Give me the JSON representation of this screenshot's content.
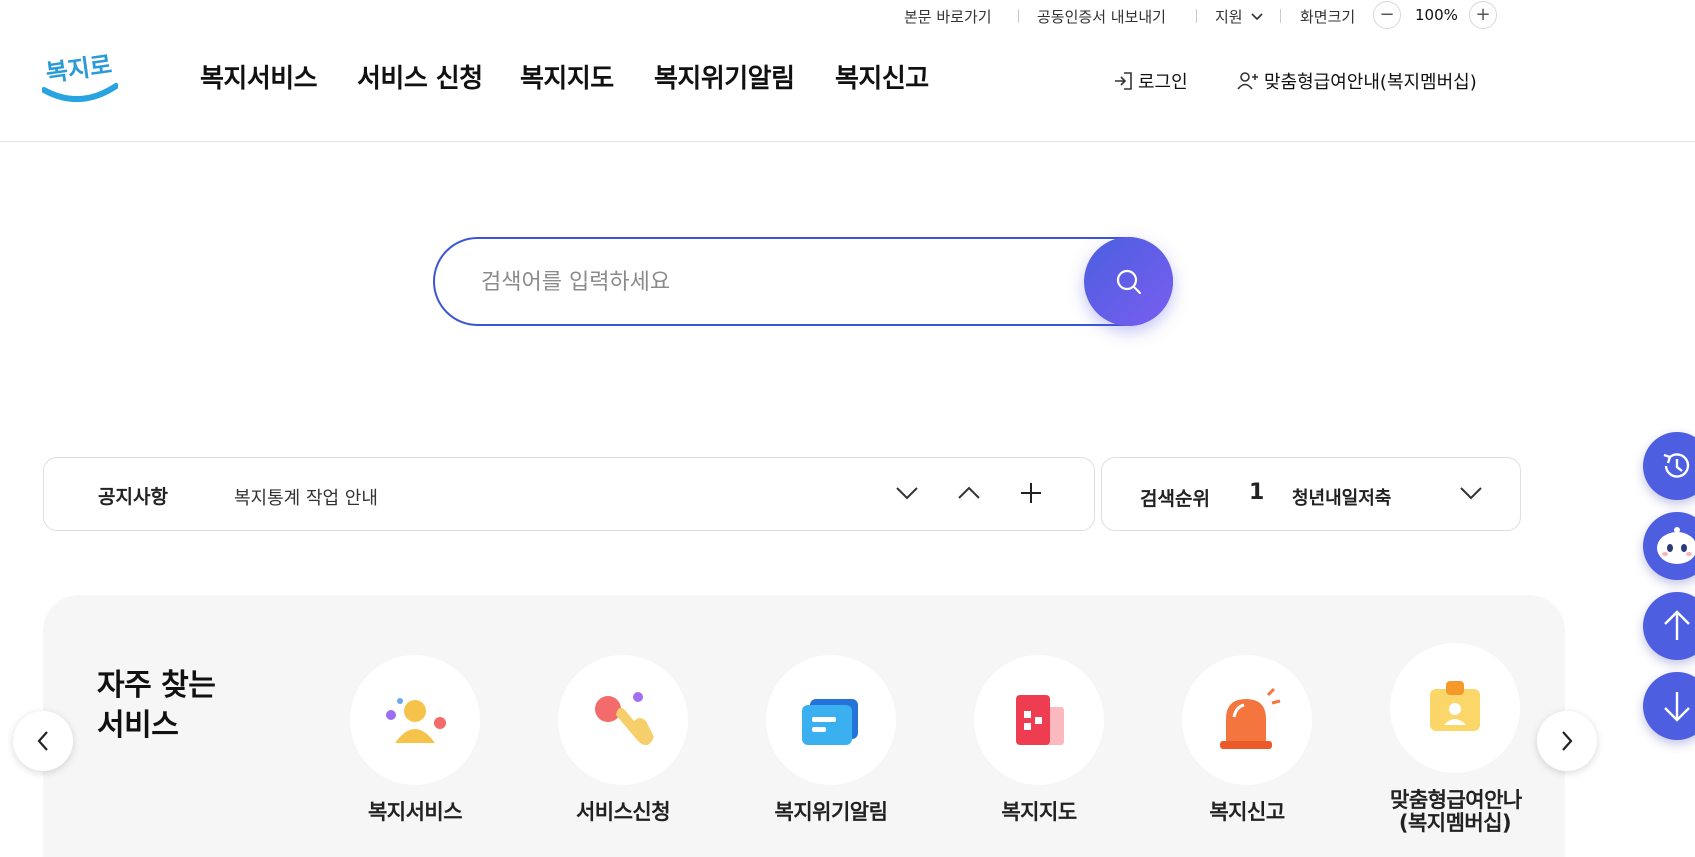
{
  "utility": {
    "skip_to_content": "본문 바로가기",
    "cert_export": "공동인증서 내보내기",
    "support": "지원",
    "screen_size_label": "화면크기",
    "zoom_value": "100%",
    "zoom_out": "−",
    "zoom_in": "+"
  },
  "logo": {
    "text": "복지로"
  },
  "nav": {
    "items": [
      "복지서비스",
      "서비스 신청",
      "복지지도",
      "복지위기알림",
      "복지신고"
    ]
  },
  "header_links": {
    "login": "로그인",
    "membership": "맞춤형급여안내(복지멤버십)"
  },
  "search": {
    "placeholder": "검색어를 입력하세요",
    "value": ""
  },
  "notice": {
    "label": "공지사항",
    "text": "복지통계 작업 안내"
  },
  "ranking": {
    "label": "검색순위",
    "rank": "1",
    "keyword": "청년내일저축"
  },
  "frequent": {
    "title_line1": "자주 찾는",
    "title_line2": "서비스",
    "items": [
      {
        "label": "복지서비스",
        "icon": "people-icon"
      },
      {
        "label": "서비스신청",
        "icon": "hand-tap-icon"
      },
      {
        "label": "복지위기알림",
        "icon": "message-icon"
      },
      {
        "label": "복지지도",
        "icon": "building-icon"
      },
      {
        "label": "복지신고",
        "icon": "siren-icon"
      },
      {
        "label_line1": "맞춤형급여안나",
        "label_line2": "(복지멤버십)",
        "icon": "id-badge-icon"
      }
    ]
  },
  "floating": [
    "history-icon",
    "chatbot-icon",
    "scroll-top-icon",
    "scroll-bottom-icon"
  ],
  "colors": {
    "primary": "#3a56d4",
    "accent": "#6a5ef0",
    "float": "#4e5ee0"
  }
}
